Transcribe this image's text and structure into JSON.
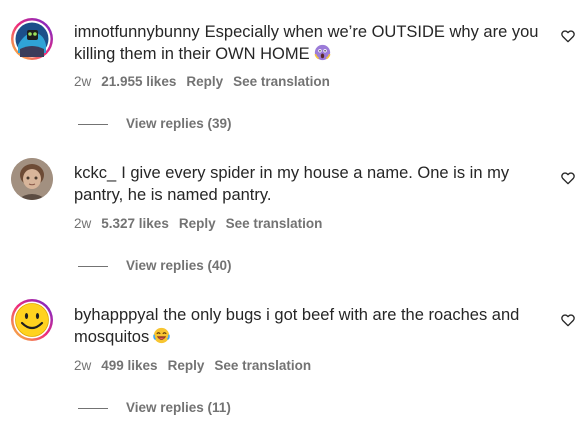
{
  "comments": [
    {
      "username": "imnotfunnybunny",
      "text": "Especially when we’re OUTSIDE why are you killing them in their OWN HOME",
      "emoji": "scream-emoji",
      "time": "2w",
      "likes": "21.955 likes",
      "reply_label": "Reply",
      "translate_label": "See translation",
      "view_replies": "View replies (39)"
    },
    {
      "username": "kckc_",
      "text": "I give every spider in my house a name. One is in my pantry, he is named pantry.",
      "emoji": "",
      "time": "2w",
      "likes": "5.327 likes",
      "reply_label": "Reply",
      "translate_label": "See translation",
      "view_replies": "View replies (40)"
    },
    {
      "username": "byhapppyal",
      "text": "the only bugs i got beef with are the roaches and mosquitos",
      "emoji": "laughing-emoji",
      "time": "2w",
      "likes": "499 likes",
      "reply_label": "Reply",
      "translate_label": "See translation",
      "view_replies": "View replies (11)"
    }
  ],
  "colors": {
    "text": "#262626",
    "secondary": "#737373",
    "story_ring_start": "#f9ce34",
    "story_ring_mid": "#ee2a7b",
    "story_ring_end": "#6228d7"
  }
}
